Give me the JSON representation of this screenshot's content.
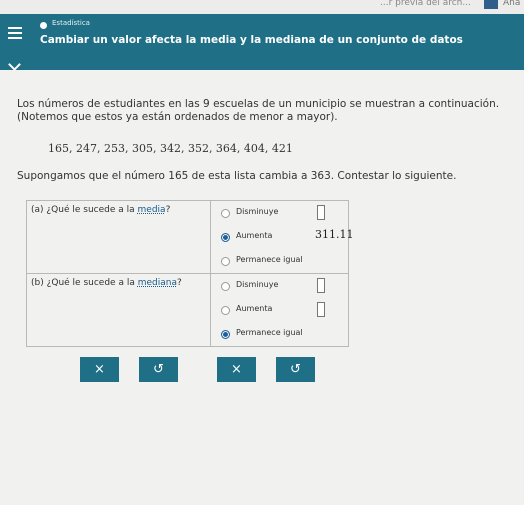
{
  "top": {
    "text": "...r previa del arch...",
    "corner": "Ana"
  },
  "header": {
    "section": "Estadística",
    "title": "Cambiar un valor afecta la media y la mediana de un conjunto de datos"
  },
  "intro": {
    "line1": "Los números de estudiantes en las 9 escuelas de un municipio se muestran a continuación.",
    "line2": "(Notemos que estos ya están ordenados de menor a mayor).",
    "numbers": "165, 247, 253, 305, 342, 352, 364, 404, 421",
    "suppose": "Supongamos que el número 165 de esta lista cambia a 363. Contestar lo siguiente."
  },
  "q1": {
    "prefix": "(a) ¿Qué le sucede a la ",
    "link": "media",
    "suffix": "?",
    "options": [
      {
        "label": "Disminuye",
        "selected": false,
        "value": "",
        "box": true
      },
      {
        "label": "Aumenta",
        "selected": true,
        "value": "311.11",
        "box": false
      },
      {
        "label": "Permanece igual",
        "selected": false,
        "value": "",
        "box": false
      }
    ]
  },
  "q2": {
    "prefix": "(b) ¿Qué le sucede a la ",
    "link": "mediana",
    "suffix": "?",
    "options": [
      {
        "label": "Disminuye",
        "selected": false,
        "value": "",
        "box": true
      },
      {
        "label": "Aumenta",
        "selected": false,
        "value": "",
        "box": true
      },
      {
        "label": "Permanece igual",
        "selected": true,
        "value": "",
        "box": false
      }
    ]
  },
  "buttons": {
    "clear": "×",
    "undo": "↺"
  },
  "colors": {
    "header": "#1f6f86",
    "selected": "#1f5f9a"
  }
}
